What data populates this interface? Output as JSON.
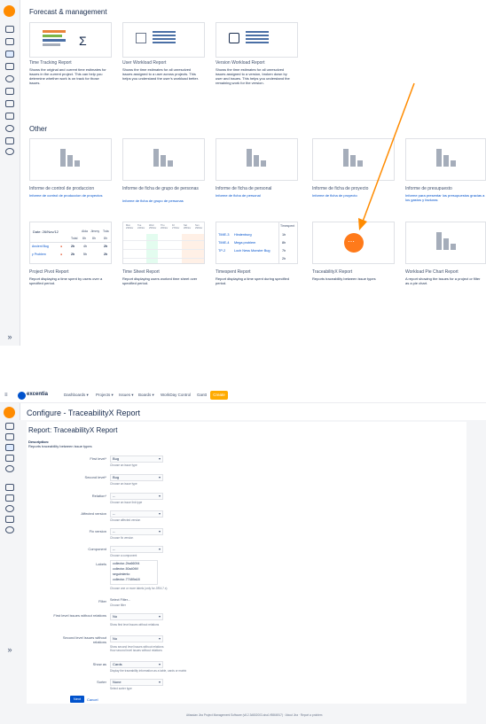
{
  "forecast": {
    "title": "Forecast & management",
    "cards": [
      {
        "title": "Time Tracking Report",
        "desc": "Shows the original and current time estimates for issues in the current project. This can help you determine whether work is on track for those issues."
      },
      {
        "title": "User Workload Report",
        "desc": "Shows the time estimates for all unresolved issues assigned to a user across projects. This helps you understand the user's workload better."
      },
      {
        "title": "Version Workload Report",
        "desc": "Shows the time estimates for all unresolved issues assigned to a version, broken down by user and issues. This helps you understand the remaining work for the version."
      }
    ]
  },
  "other": {
    "title": "Other",
    "cards_row1": [
      {
        "title": "Informe de control de produccion",
        "desc": "Informe de control de produccion de proyectos"
      },
      {
        "title": "Informe de ficha de grupo de personas",
        "desc": "Informe de ficha de grupo de personas"
      },
      {
        "title": "Informe de ficha de personal",
        "desc": "Informe de ficha de personal"
      },
      {
        "title": "Informe de ficha de proyecto",
        "desc": "Informe de ficha de proyecto"
      },
      {
        "title": "Informe de presupuesto",
        "desc": "Informe para presentar los presupuestos gracias a los gastos y facturas"
      }
    ],
    "cards_row2": [
      {
        "title": "Project Pivot Report",
        "desc": "Report displaying a time spent by users over a specified period."
      },
      {
        "title": "Time Sheet Report",
        "desc": "Report displaying users worked time sheet over specified period."
      },
      {
        "title": "Timespent Report",
        "desc": "Report displaying a time spent during specified period."
      },
      {
        "title": "TraceabilityX Report",
        "desc": "Reports traceability between issue types"
      },
      {
        "title": "Workload Pie Chart Report",
        "desc": "A report showing the issues for a project or filter as a pie chart."
      }
    ],
    "pivot_thumb": {
      "date": "Date: 26/Nov/12",
      "cols": [
        "Alda",
        "Jimmy",
        "Tota"
      ],
      "sub": [
        "Total",
        "8h",
        "8h",
        "8h"
      ],
      "rows": [
        [
          "Ancient Bug",
          "2h",
          "4h",
          "2h"
        ],
        [
          "y Problem",
          "2h",
          "5h",
          "2h"
        ]
      ]
    },
    "timesheet_thumb": {
      "days": [
        "Mon 23/Nov",
        "Tue 24/Nov",
        "Wed 25/Nov",
        "Thu 26/Nov",
        "Fri 27/Nov",
        "Sat 28/Nov",
        "Sun 29/Nov"
      ]
    },
    "timespent_thumb": {
      "header": "Timespent",
      "rows": [
        [
          "TIME-3",
          "Hindenburg",
          "1h"
        ],
        [
          "TIME-4",
          "Mega problem",
          "8h"
        ],
        [
          "TP-2",
          "Loch Ness Monster Bug",
          "7h"
        ],
        [
          "",
          "",
          "2h"
        ]
      ]
    }
  },
  "topbar": {
    "brand": "excentia",
    "nav": [
      "Dashboards ▾",
      "Projects ▾",
      "Issues ▾",
      "Boards ▾",
      "WorkDay Control",
      "Gantt"
    ],
    "create": "Create"
  },
  "configure": {
    "page_title": "Configure - TraceabilityX Report",
    "report_title": "Report: TraceabilityX Report",
    "desc_label": "Description:",
    "desc_text": "Reports traceability between issue types",
    "fields": [
      {
        "label": "First level*",
        "value": "Bug",
        "help": "Choose an issue type"
      },
      {
        "label": "Second level*",
        "value": "Bug",
        "help": "Choose an issue type"
      },
      {
        "label": "Relation*",
        "value": "--",
        "help": "Choose an issue link type"
      },
      {
        "label": "Affected version",
        "value": "--",
        "help": "Choose affected version"
      },
      {
        "label": "Fix version",
        "value": "--",
        "help": "Choose fix version"
      },
      {
        "label": "Component",
        "value": "--",
        "help": "Choose a component"
      }
    ],
    "labels_field": {
      "label": "Labels",
      "options": [
        "collector-2bc66094",
        "collector-50a40f4f",
        "seguimiento",
        "collector-77489a18"
      ],
      "help": "Choose one or more labels (only for JIRA 7.x)"
    },
    "filter_field": {
      "label": "Filter",
      "value": "Select Filter...",
      "help": "Choose filter"
    },
    "first_without": {
      "label": "First level issues without relations",
      "value": "No",
      "help": "Show first level issues without relations"
    },
    "second_without": {
      "label": "Second level issues without relations",
      "value": "No",
      "help": "Show second level issues without relations\nHow second level issues without relations"
    },
    "show_as": {
      "label": "Show as",
      "value": "Cards",
      "help": "Display the traceability information as a table, cards or matrix"
    },
    "sorter": {
      "label": "Sorter",
      "value": "None",
      "help": "Select sorter type"
    },
    "next": "Next",
    "cancel": "Cancel"
  },
  "footer": {
    "text": "Atlassian Jira Project Management Software (v8.2.3#802003-sha1:f9866917)  ·  About Jira  ·  Report a problem"
  },
  "colors": {
    "accent": "#ff8b00",
    "link": "#0052cc",
    "create": "#ffab00",
    "next": "#0052cc"
  }
}
